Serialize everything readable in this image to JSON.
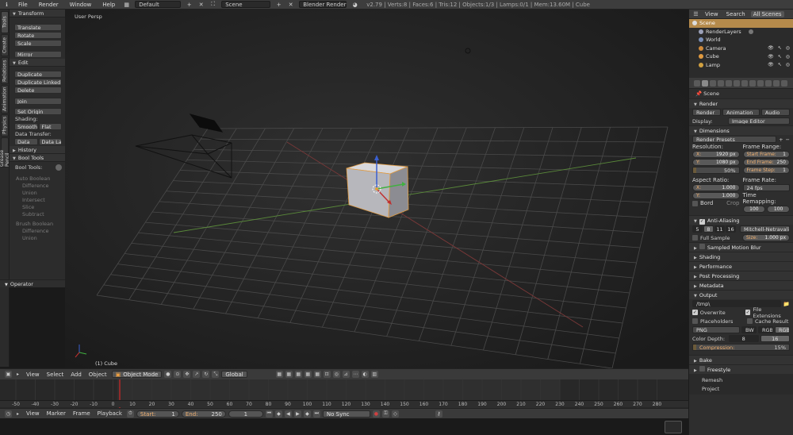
{
  "top_bar": {
    "menus": [
      "File",
      "Render",
      "Window",
      "Help"
    ],
    "layout": "Default",
    "scene": "Scene",
    "engine": "Blender Render",
    "stats": "v2.79 | Verts:8 | Faces:6 | Tris:12 | Objects:1/3 | Lamps:0/1 | Mem:13.60M | Cube"
  },
  "shelf_tabs": [
    "Tools",
    "Create",
    "Relations",
    "Animation",
    "Physics",
    "Grease Pencil"
  ],
  "shelf": {
    "transform_header": "Transform",
    "translate": "Translate",
    "rotate": "Rotate",
    "scale": "Scale",
    "mirror": "Mirror",
    "edit_header": "Edit",
    "duplicate": "Duplicate",
    "duplicate_linked": "Duplicate Linked",
    "delete": "Delete",
    "join": "Join",
    "set_origin": "Set Origin",
    "shading_label": "Shading:",
    "smooth": "Smooth",
    "flat": "Flat",
    "data_transfer_label": "Data Transfer:",
    "data": "Data",
    "data_layers": "Data La",
    "history_header": "History",
    "bool_tools_header": "Bool Tools",
    "bool_tools_label": "Bool Tools:",
    "auto_boolean": "Auto Boolean",
    "difference": "Difference",
    "union": "Union",
    "intersect": "Intersect",
    "slice": "Slice",
    "subtract": "Subtract",
    "brush_boolean": "Brush Boolean",
    "difference2": "Difference",
    "union2": "Union",
    "operator_header": "Operator"
  },
  "viewport": {
    "view_name": "User Persp",
    "object_label": "(1) Cube"
  },
  "view3d_header": {
    "menus": [
      "View",
      "Select",
      "Add",
      "Object"
    ],
    "mode": "Object Mode",
    "orientation": "Global"
  },
  "timeline": {
    "ticks": [
      "-50",
      "-40",
      "-30",
      "-20",
      "-10",
      "0",
      "10",
      "20",
      "30",
      "40",
      "50",
      "60",
      "70",
      "80",
      "90",
      "100",
      "110",
      "120",
      "130",
      "140",
      "150",
      "160",
      "170",
      "180",
      "190",
      "200",
      "210",
      "220",
      "230",
      "240",
      "250",
      "260",
      "270",
      "280"
    ],
    "menus": [
      "View",
      "Marker",
      "Frame",
      "Playback"
    ],
    "start_label": "Start:",
    "start": "1",
    "end_label": "End:",
    "end": "250",
    "current": "1",
    "sync": "No Sync"
  },
  "outliner": {
    "tabs": [
      "View",
      "Search",
      "All Scenes"
    ],
    "rows": [
      {
        "label": "Scene",
        "color": "#e0e0e0"
      },
      {
        "label": "RenderLayers",
        "color": "#9aa0b8"
      },
      {
        "label": "World",
        "color": "#7a8fb8"
      },
      {
        "label": "Camera",
        "color": "#d08a3a"
      },
      {
        "label": "Cube",
        "color": "#e09a40"
      },
      {
        "label": "Lamp",
        "color": "#d0a040"
      }
    ]
  },
  "properties": {
    "breadcrumb": "Scene",
    "render_header": "Render",
    "render_btn": "Render",
    "animation_btn": "Animation",
    "audio_btn": "Audio",
    "display_label": "Display:",
    "display_value": "Image Editor",
    "dimensions_header": "Dimensions",
    "render_presets": "Render Presets",
    "resolution_label": "Resolution:",
    "res_x_key": "X:",
    "res_x": "1920 px",
    "res_y_key": "Y:",
    "res_y": "1080 px",
    "res_pct": "50%",
    "resolution_percent": 50,
    "frame_range_label": "Frame Range:",
    "start_frame_key": "Start Frame:",
    "start_frame": "1",
    "end_frame_key": "End Frame:",
    "end_frame": "250",
    "frame_step_key": "Frame Step:",
    "frame_step": "1",
    "aspect_label": "Aspect Ratio:",
    "aspect_x": "1.000",
    "aspect_y": "1.000",
    "frame_rate_label": "Frame Rate:",
    "frame_rate": "24 fps",
    "time_remap_label": "Time Remapping:",
    "remap_old": "100",
    "remap_new": "100",
    "border": "Bord",
    "crop": "Crop",
    "aa_header": "Anti-Aliasing",
    "aa_samples": [
      "5",
      "8",
      "11",
      "16"
    ],
    "aa_filter": "Mitchell-Netravali",
    "full_sample": "Full Sample",
    "size_key": "Size:",
    "size": "1.000 px",
    "motion_blur_header": "Sampled Motion Blur",
    "shading_header": "Shading",
    "performance_header": "Performance",
    "post_header": "Post Processing",
    "metadata_header": "Metadata",
    "output_header": "Output",
    "output_path": "/tmp\\",
    "overwrite": "Overwrite",
    "file_ext": "File Extensions",
    "placeholders": "Placeholders",
    "cache_result": "Cache Result",
    "format": "PNG",
    "bw": "BW",
    "rgb": "RGB",
    "rgba": "RGBA",
    "color_depth_label": "Color Depth:",
    "depth8": "8",
    "depth16": "16",
    "compression_label": "Compression:",
    "compression": "15%",
    "compression_percent": 15,
    "bake_header": "Bake",
    "freestyle_header": "Freestyle",
    "remesh": "Remesh",
    "project": "Project"
  }
}
